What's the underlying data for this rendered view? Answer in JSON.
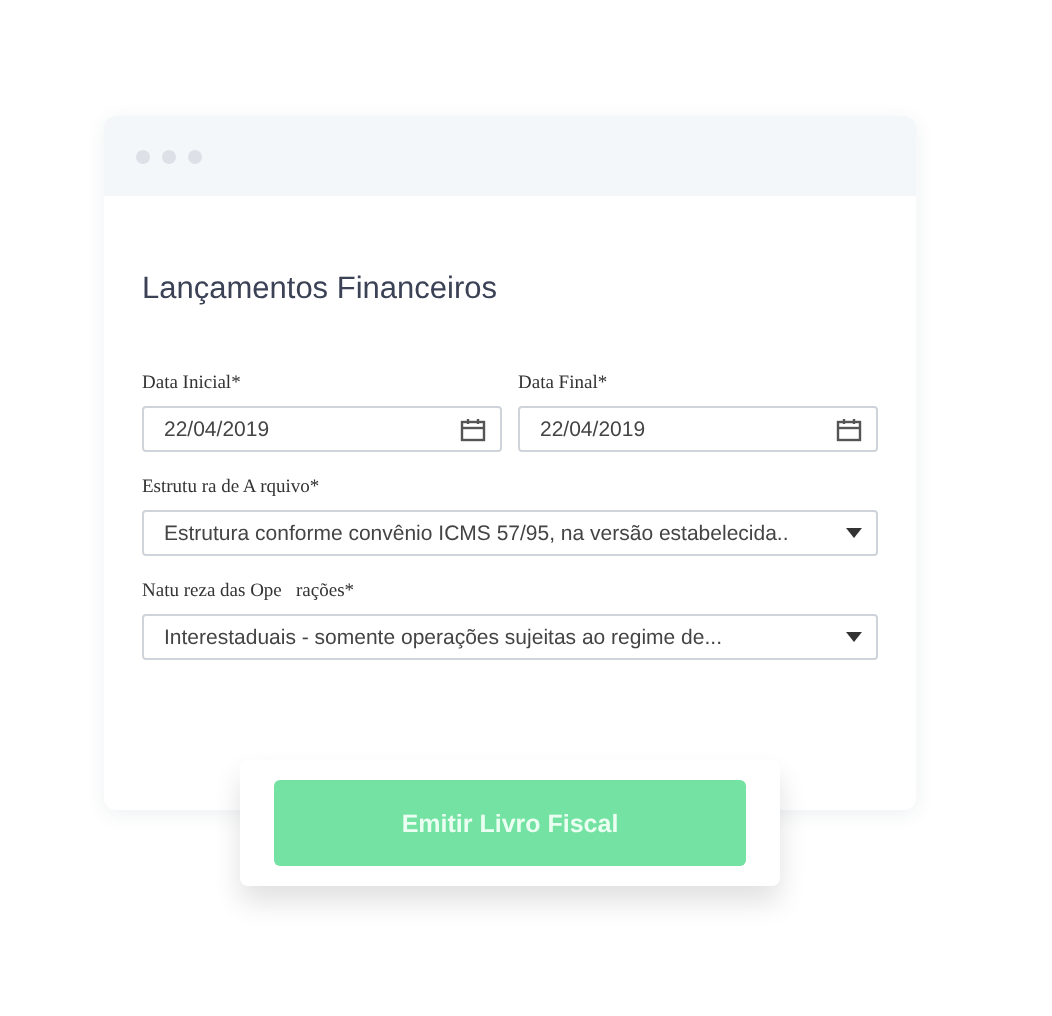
{
  "window": {
    "title": "Lançamentos Financeiros"
  },
  "date_fields": [
    {
      "label": "Data Inicial*",
      "value": "22/04/2019"
    },
    {
      "label": "Data Final*",
      "value": "22/04/2019"
    }
  ],
  "selects": [
    {
      "label": "Estrutu ra de A rquivo*",
      "value": "Estrutura conforme convênio ICMS 57/95, na versão estabelecida.."
    },
    {
      "label": "Natu reza das Ope   rações*",
      "value": "Interestaduais - somente operações sujeitas ao regime de..."
    }
  ],
  "button": {
    "label": "Emitir Livro Fiscal"
  }
}
